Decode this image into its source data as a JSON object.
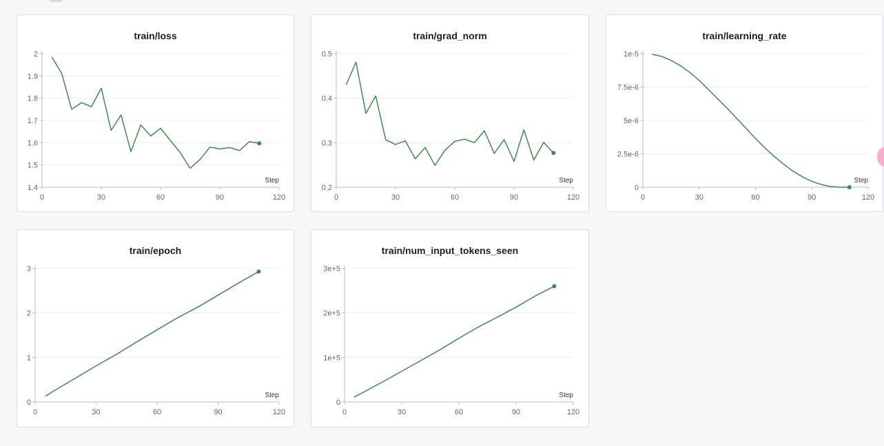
{
  "colors": {
    "line": "#3f8a4a",
    "grid": "#ececf0",
    "axis": "#b9bcc4",
    "tick": "#666666",
    "title": "#1d1d1d"
  },
  "chart_data": [
    {
      "type": "line",
      "title": "train/loss",
      "xlabel": "Step",
      "xlim": [
        0,
        120
      ],
      "xticks": [
        "0",
        "30",
        "60",
        "90",
        "120"
      ],
      "ylim": [
        1.4,
        2.0
      ],
      "yticks": [
        {
          "v": 1.4,
          "label": "1.4"
        },
        {
          "v": 1.5,
          "label": "1.5"
        },
        {
          "v": 1.6,
          "label": "1.6"
        },
        {
          "v": 1.7,
          "label": "1.7"
        },
        {
          "v": 1.8,
          "label": "1.8"
        },
        {
          "v": 1.9,
          "label": "1.9"
        },
        {
          "v": 2.0,
          "label": "2"
        }
      ],
      "series": [
        {
          "x": [
            5,
            10,
            15,
            20,
            25,
            30,
            35,
            40,
            45,
            50,
            55,
            60,
            65,
            70,
            75,
            80,
            85,
            90,
            95,
            100,
            105,
            110
          ],
          "y": [
            1.985,
            1.91,
            1.75,
            1.78,
            1.762,
            1.845,
            1.655,
            1.725,
            1.56,
            1.68,
            1.63,
            1.665,
            1.61,
            1.555,
            1.485,
            1.525,
            1.58,
            1.572,
            1.578,
            1.565,
            1.605,
            1.597
          ]
        }
      ]
    },
    {
      "type": "line",
      "title": "train/grad_norm",
      "xlabel": "Step",
      "xlim": [
        0,
        120
      ],
      "xticks": [
        "0",
        "30",
        "60",
        "90",
        "120"
      ],
      "ylim": [
        0.2,
        0.5
      ],
      "yticks": [
        {
          "v": 0.2,
          "label": "0.2"
        },
        {
          "v": 0.3,
          "label": "0.3"
        },
        {
          "v": 0.4,
          "label": "0.4"
        },
        {
          "v": 0.5,
          "label": "0.5"
        }
      ],
      "series": [
        {
          "x": [
            5,
            10,
            15,
            20,
            25,
            30,
            35,
            40,
            45,
            50,
            55,
            60,
            65,
            70,
            75,
            80,
            85,
            90,
            95,
            100,
            105,
            110
          ],
          "y": [
            0.43,
            0.481,
            0.366,
            0.405,
            0.307,
            0.296,
            0.304,
            0.264,
            0.289,
            0.249,
            0.283,
            0.303,
            0.308,
            0.3,
            0.327,
            0.276,
            0.307,
            0.258,
            0.329,
            0.261,
            0.301,
            0.277
          ]
        }
      ]
    },
    {
      "type": "line",
      "title": "train/learning_rate",
      "xlabel": "Step",
      "xlim": [
        0,
        120
      ],
      "xticks": [
        "0",
        "30",
        "60",
        "90",
        "120"
      ],
      "ylim": [
        0,
        1e-05
      ],
      "yticks": [
        {
          "v": 0,
          "label": "0"
        },
        {
          "v": 2.5e-06,
          "label": "2.5e-6"
        },
        {
          "v": 5e-06,
          "label": "5e-6"
        },
        {
          "v": 7.5e-06,
          "label": "7.5e-6"
        },
        {
          "v": 1e-05,
          "label": "1e-5"
        }
      ],
      "series": [
        {
          "x": [
            5,
            10,
            15,
            20,
            25,
            30,
            35,
            40,
            45,
            50,
            55,
            60,
            65,
            70,
            75,
            80,
            85,
            90,
            95,
            100,
            105,
            110
          ],
          "y": [
            9.95e-06,
            9.8e-06,
            9.5e-06,
            9.1e-06,
            8.6e-06,
            8e-06,
            7.3e-06,
            6.6e-06,
            5.9e-06,
            5.15e-06,
            4.4e-06,
            3.65e-06,
            2.95e-06,
            2.3e-06,
            1.72e-06,
            1.2e-06,
            7.8e-07,
            4.4e-07,
            2e-07,
            5e-08,
            0,
            0
          ]
        }
      ]
    },
    {
      "type": "line",
      "title": "train/epoch",
      "xlabel": "Step",
      "xlim": [
        0,
        120
      ],
      "xticks": [
        "0",
        "30",
        "60",
        "90",
        "120"
      ],
      "ylim": [
        0,
        3
      ],
      "yticks": [
        {
          "v": 0,
          "label": "0"
        },
        {
          "v": 1,
          "label": "1"
        },
        {
          "v": 2,
          "label": "2"
        },
        {
          "v": 3,
          "label": "3"
        }
      ],
      "series": [
        {
          "x": [
            5,
            10,
            20,
            30,
            40,
            50,
            60,
            70,
            80,
            90,
            100,
            110
          ],
          "y": [
            0.13,
            0.27,
            0.54,
            0.81,
            1.07,
            1.35,
            1.62,
            1.89,
            2.13,
            2.4,
            2.67,
            2.93
          ]
        }
      ]
    },
    {
      "type": "line",
      "title": "train/num_input_tokens_seen",
      "xlabel": "Step",
      "xlim": [
        0,
        120
      ],
      "xticks": [
        "0",
        "30",
        "60",
        "90",
        "120"
      ],
      "ylim": [
        0,
        300000
      ],
      "yticks": [
        {
          "v": 0,
          "label": "0"
        },
        {
          "v": 100000,
          "label": "1e+5"
        },
        {
          "v": 200000,
          "label": "2e+5"
        },
        {
          "v": 300000,
          "label": "3e+5"
        }
      ],
      "series": [
        {
          "x": [
            5,
            10,
            20,
            30,
            40,
            50,
            60,
            70,
            80,
            90,
            100,
            110
          ],
          "y": [
            11000,
            22000,
            45000,
            69000,
            93000,
            117000,
            143000,
            168000,
            190000,
            213000,
            238000,
            260000
          ]
        }
      ]
    }
  ]
}
